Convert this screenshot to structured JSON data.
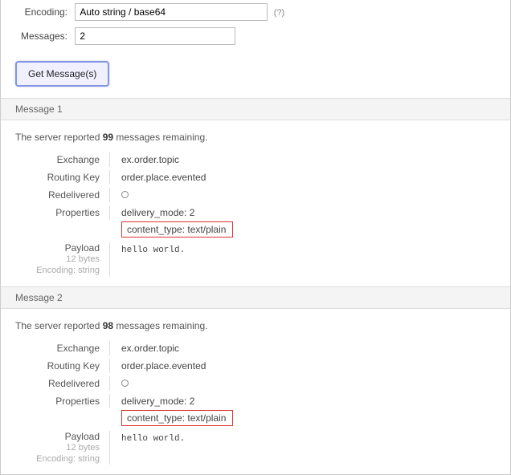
{
  "form": {
    "encoding_label": "Encoding:",
    "encoding_value": "Auto string / base64",
    "encoding_help": "(?)",
    "messages_label": "Messages:",
    "messages_value": "2",
    "button_label": "Get Message(s)"
  },
  "labels": {
    "exchange": "Exchange",
    "routing_key": "Routing Key",
    "redelivered": "Redelivered",
    "properties": "Properties",
    "payload": "Payload"
  },
  "messages": [
    {
      "header": "Message 1",
      "remaining_pre": "The server reported ",
      "remaining_count": "99",
      "remaining_post": " messages remaining.",
      "exchange": "ex.order.topic",
      "routing_key": "order.place.evented",
      "redelivered": "○",
      "delivery_mode": "delivery_mode: 2",
      "content_type": "content_type: text/plain",
      "payload_size": "12 bytes",
      "payload_encoding": "Encoding: string",
      "payload_body": "hello world."
    },
    {
      "header": "Message 2",
      "remaining_pre": "The server reported ",
      "remaining_count": "98",
      "remaining_post": " messages remaining.",
      "exchange": "ex.order.topic",
      "routing_key": "order.place.evented",
      "redelivered": "○",
      "delivery_mode": "delivery_mode: 2",
      "content_type": "content_type: text/plain",
      "payload_size": "12 bytes",
      "payload_encoding": "Encoding: string",
      "payload_body": "hello world."
    }
  ]
}
